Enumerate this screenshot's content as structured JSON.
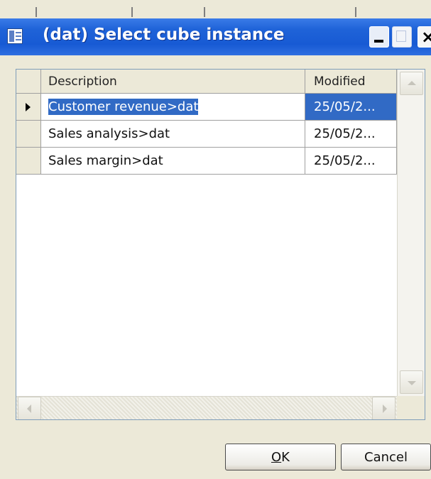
{
  "window": {
    "title": "(dat) Select cube instance",
    "icon": "form-window-icon",
    "controls": {
      "minimize": "minimize-icon",
      "maximize": "maximize-icon",
      "close": "close-icon"
    }
  },
  "grid": {
    "columns": [
      "Description",
      "Modified"
    ],
    "rows": [
      {
        "description": "Customer revenue>dat",
        "modified": "25/05/2...",
        "selected": true
      },
      {
        "description": "Sales analysis>dat",
        "modified": "25/05/2...",
        "selected": false
      },
      {
        "description": "Sales margin>dat",
        "modified": "25/05/2...",
        "selected": false
      }
    ],
    "current_row_indicator": "row-pointer-icon"
  },
  "buttons": {
    "ok_accel": "O",
    "ok_rest": "K",
    "cancel": "Cancel"
  },
  "colors": {
    "titlebar": "#1f63d8",
    "selection": "#316ac5",
    "dialog_bg": "#ece9d8"
  }
}
